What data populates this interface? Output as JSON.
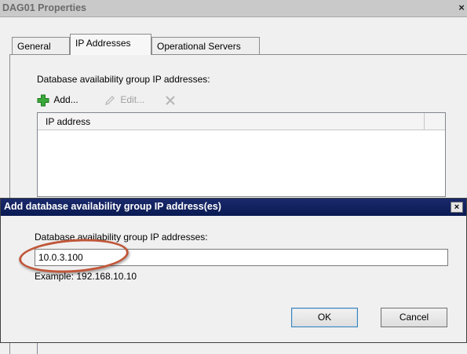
{
  "outer_dialog": {
    "title": "DAG01 Properties",
    "close_glyph": "×",
    "tabs": [
      {
        "label": "General",
        "active": false
      },
      {
        "label": "IP Addresses",
        "active": true
      },
      {
        "label": "Operational Servers",
        "active": false
      }
    ],
    "section_label": "Database availability group IP addresses:",
    "toolbar": {
      "add_label": "Add...",
      "edit_label": "Edit...",
      "add_icon": "green-plus-icon",
      "edit_icon": "pencil-icon",
      "remove_icon": "remove-x-icon"
    },
    "list": {
      "columns": [
        "IP address"
      ]
    }
  },
  "front_dialog": {
    "title": "Add database availability group IP address(es)",
    "close_glyph": "×",
    "field_label": "Database availability group IP addresses:",
    "field_value": "10.0.3.100",
    "example_text": "Example: 192.168.10.10",
    "ok_label": "OK",
    "cancel_label": "Cancel"
  },
  "colors": {
    "front_titlebar": "#0a1a52",
    "highlight_circle": "#c0573a",
    "add_icon_green": "#3aa83a"
  }
}
